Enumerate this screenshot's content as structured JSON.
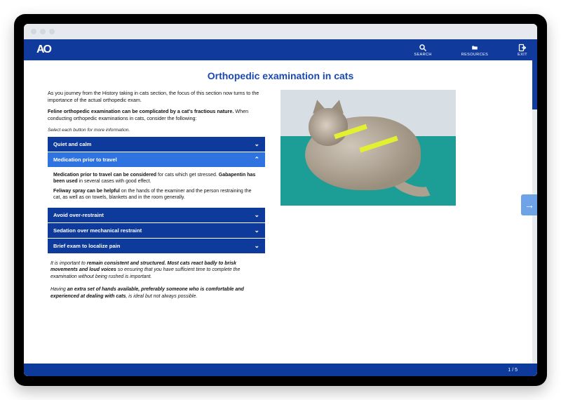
{
  "topbar": {
    "logo": "AO",
    "search_label": "SEARCH",
    "resources_label": "RESOURCES",
    "exit_label": "EXIT"
  },
  "page": {
    "title": "Orthopedic examination in cats",
    "intro1": "As you journey from the History taking in cats section, the focus of this section now turns to the importance of the actual orthopedic exam.",
    "intro2_bold": "Feline orthopedic examination can be complicated by a cat's fractious nature.",
    "intro2_tail": " When conducting orthopedic examinations in cats, consider the following:",
    "instruction": "Select each button for more information.",
    "page_indicator": "1 / 5"
  },
  "accordion": {
    "items": [
      {
        "label": "Quiet and calm",
        "open": false
      },
      {
        "label": "Medication prior to travel",
        "open": true
      },
      {
        "label": "Avoid over-restraint",
        "open": false
      },
      {
        "label": "Sedation over mechanical restraint",
        "open": false
      },
      {
        "label": "Brief exam to localize pain",
        "open": false
      }
    ],
    "open_body": {
      "p1_bold": "Medication prior to travel can be considered",
      "p1_tail": " for cats which get stressed. ",
      "p1b_bold": "Gabapentin has been used",
      "p1b_tail": " in several cases with good effect.",
      "p2_bold": "Feliway spray can be helpful",
      "p2_tail": " on the hands of the examiner and the person restraining the cat, as well as on towels, blankets and in the room generally."
    }
  },
  "notes": {
    "n1a": "It is important to ",
    "n1b": "remain consistent and structured. Most cats react badly to brisk movements and loud voices",
    "n1c": " so ensuring that you have sufficient time to complete the examination without being rushed is important.",
    "n2a": "Having ",
    "n2b": "an extra set of hands available, preferably someone who is comfortable and experienced at dealing with cats",
    "n2c": ", is ideal but not always possible."
  },
  "image": {
    "alt": "Long-haired grey cat wearing a yellow harness lying on a teal table"
  }
}
